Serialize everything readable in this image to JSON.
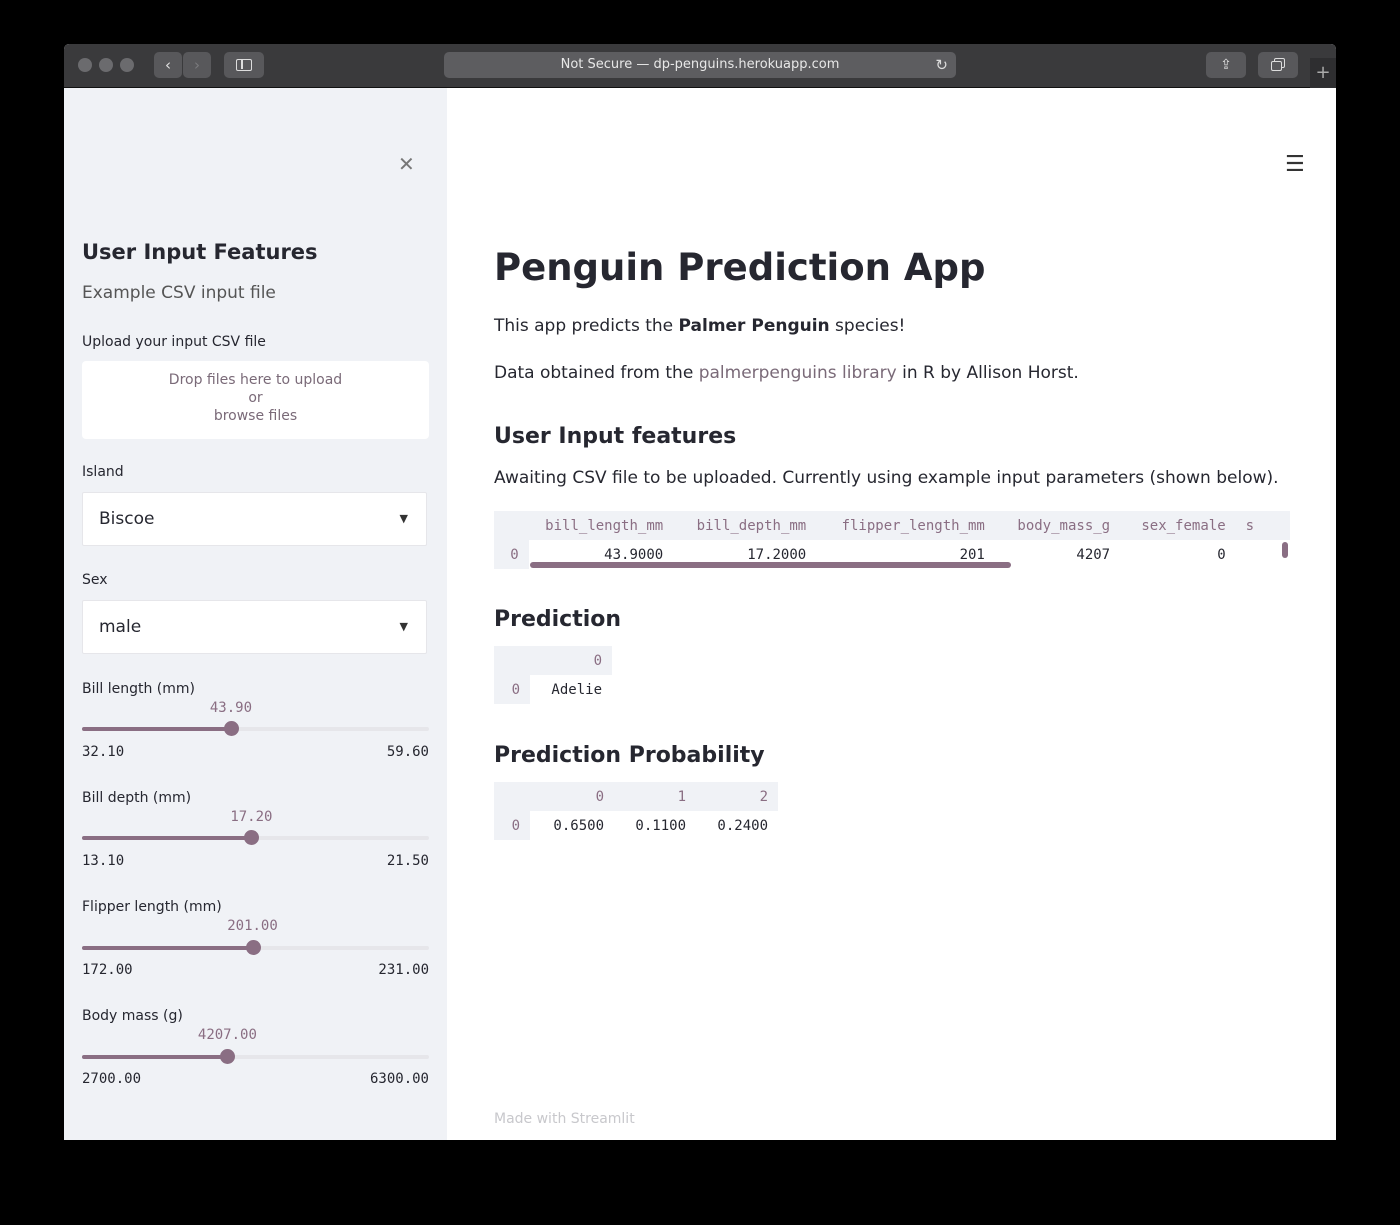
{
  "browser": {
    "url": "Not Secure — dp-penguins.herokuapp.com",
    "back_icon": "‹",
    "forward_icon": "›",
    "reload_icon": "↻",
    "share_icon": "⇪",
    "new_tab_icon": "+"
  },
  "sidebar": {
    "close_icon": "✕",
    "title": "User Input Features",
    "subtitle": "Example CSV input file",
    "upload_label": "Upload your input CSV file",
    "upload_line1": "Drop files here to upload",
    "upload_line2": "or",
    "upload_line3": "browse files",
    "island_label": "Island",
    "island_value": "Biscoe",
    "sex_label": "Sex",
    "sex_value": "male",
    "caret_icon": "▼",
    "sliders": [
      {
        "label": "Bill length (mm)",
        "value": "43.90",
        "min": "32.10",
        "max": "59.60",
        "fraction": 0.429
      },
      {
        "label": "Bill depth (mm)",
        "value": "17.20",
        "min": "13.10",
        "max": "21.50",
        "fraction": 0.488
      },
      {
        "label": "Flipper length (mm)",
        "value": "201.00",
        "min": "172.00",
        "max": "231.00",
        "fraction": 0.492
      },
      {
        "label": "Body mass (g)",
        "value": "4207.00",
        "min": "2700.00",
        "max": "6300.00",
        "fraction": 0.419
      }
    ]
  },
  "main": {
    "menu_icon": "☰",
    "title": "Penguin Prediction App",
    "intro_prefix": "This app predicts the ",
    "intro_bold": "Palmer Penguin",
    "intro_suffix": " species!",
    "data_prefix": "Data obtained from the ",
    "data_link": "palmerpenguins library",
    "data_suffix": " in R by Allison Horst.",
    "features_heading": "User Input features",
    "features_note": "Awaiting CSV file to be uploaded. Currently using example input parameters (shown below).",
    "features_table": {
      "columns": [
        "bill_length_mm",
        "bill_depth_mm",
        "flipper_length_mm",
        "body_mass_g",
        "sex_female",
        "s"
      ],
      "index": "0",
      "row": [
        "43.9000",
        "17.2000",
        "201",
        "4207",
        "0",
        ""
      ]
    },
    "prediction_heading": "Prediction",
    "prediction_table": {
      "column": "0",
      "index": "0",
      "value": "Adelie"
    },
    "probability_heading": "Prediction Probability",
    "probability_table": {
      "columns": [
        "0",
        "1",
        "2"
      ],
      "index": "0",
      "row": [
        "0.6500",
        "0.1100",
        "0.2400"
      ]
    },
    "footer": "Made with Streamlit"
  }
}
